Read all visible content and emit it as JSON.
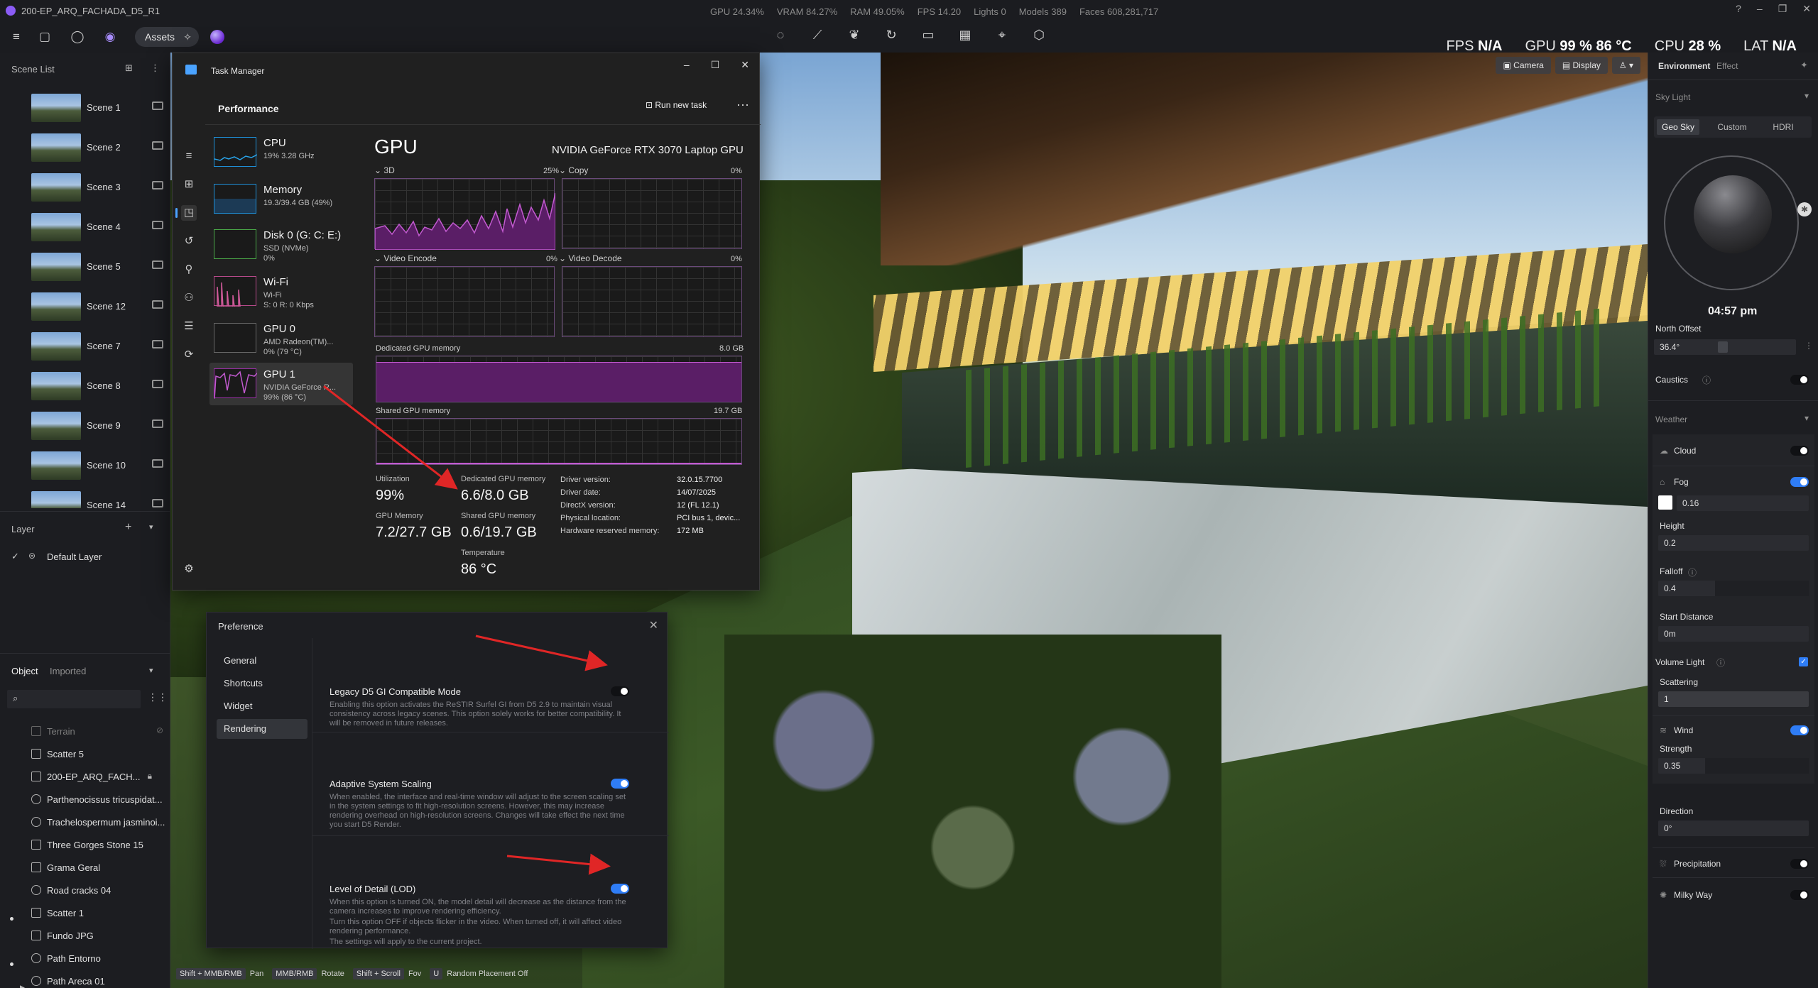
{
  "titlebar": {
    "title": "200-EP_ARQ_FACHADA_D5_R1",
    "stats": [
      "GPU 24.34%",
      "VRAM 84.27%",
      "RAM 49.05%",
      "FPS 14.20",
      "Lights 0",
      "Models 389",
      "Faces 608,281,717"
    ]
  },
  "toolbar": {
    "assets_label": "Assets"
  },
  "hud": {
    "fps_label": "FPS",
    "fps_value": "N/A",
    "gpu_label": "GPU",
    "gpu_value": "99 %  86 °C",
    "cpu_label": "CPU",
    "cpu_value": "28 %",
    "lat_label": "LAT",
    "lat_value": "N/A"
  },
  "left_panel": {
    "scene_list_title": "Scene List",
    "scenes": [
      "Scene 1",
      "Scene 2",
      "Scene 3",
      "Scene 4",
      "Scene 5",
      "Scene 12",
      "Scene 7",
      "Scene 8",
      "Scene 9",
      "Scene 10",
      "Scene 14"
    ],
    "layer_title": "Layer",
    "layer_default": "Default Layer",
    "tabs": [
      "Object",
      "Imported"
    ],
    "objects": [
      "Terrain",
      "Scatter 5",
      "200-EP_ARQ_FACH...",
      "Parthenocissus tricuspidat...",
      "Trachelospermum jasminoi...",
      "Three Gorges Stone 15",
      "Grama Geral",
      "Road cracks 04",
      "Scatter 1",
      "Fundo JPG",
      "Path Entorno",
      "Path Areca 01"
    ]
  },
  "viewport": {
    "buttons": [
      "Camera",
      "Display"
    ],
    "shortcuts": [
      {
        "key": "Shift + MMB/RMB",
        "action": "Pan"
      },
      {
        "key": "MMB/RMB",
        "action": "Rotate"
      },
      {
        "key": "Shift + Scroll",
        "action": "Fov"
      },
      {
        "key": "U",
        "action": "Random Placement Off"
      }
    ]
  },
  "right_panel": {
    "tabs": [
      "Environment",
      "Effect"
    ],
    "sky_light": "Sky Light",
    "sky_modes": [
      "Geo Sky",
      "Custom",
      "HDRI"
    ],
    "time": "04:57 pm",
    "north_offset_label": "North Offset",
    "north_offset_value": "36.4°",
    "caustics": "Caustics",
    "weather": "Weather",
    "cloud": "Cloud",
    "fog": "Fog",
    "fog_value": "0.16",
    "height_label": "Height",
    "height_value": "0.2",
    "falloff_label": "Falloff",
    "falloff_value": "0.4",
    "start_distance_label": "Start Distance",
    "start_distance_value": "0m",
    "volume_light": "Volume Light",
    "scattering_label": "Scattering",
    "scattering_value": "1",
    "wind": "Wind",
    "strength_label": "Strength",
    "strength_value": "0.35",
    "direction_label": "Direction",
    "direction_value": "0°",
    "precipitation": "Precipitation",
    "milky_way": "Milky Way"
  },
  "task_manager": {
    "title": "Task Manager",
    "section": "Performance",
    "run_new_task": "Run new task",
    "side_items": [
      {
        "name": "CPU",
        "sub1": "19%  3.28 GHz",
        "sub2": ""
      },
      {
        "name": "Memory",
        "sub1": "19.3/39.4 GB (49%)",
        "sub2": ""
      },
      {
        "name": "Disk 0 (G: C: E:)",
        "sub1": "SSD (NVMe)",
        "sub2": "0%"
      },
      {
        "name": "Wi-Fi",
        "sub1": "Wi-Fi",
        "sub2": "S: 0  R: 0 Kbps"
      },
      {
        "name": "GPU 0",
        "sub1": "AMD Radeon(TM)...",
        "sub2": "0%  (79 °C)"
      },
      {
        "name": "GPU 1",
        "sub1": "NVIDIA GeForce R...",
        "sub2": "99%  (86 °C)"
      }
    ],
    "gpu_title": "GPU",
    "gpu_model": "NVIDIA GeForce RTX 3070 Laptop GPU",
    "graphs": {
      "g3d": {
        "label": "3D",
        "pct": "25%"
      },
      "copy": {
        "label": "Copy",
        "pct": "0%"
      },
      "venc": {
        "label": "Video Encode",
        "pct": "0%"
      },
      "vdec": {
        "label": "Video Decode",
        "pct": "0%"
      },
      "dedicated": {
        "label": "Dedicated GPU memory",
        "max": "8.0 GB"
      },
      "shared": {
        "label": "Shared GPU memory",
        "max": "19.7 GB"
      }
    },
    "stats": {
      "utilization_label": "Utilization",
      "utilization": "99%",
      "dedicated_label": "Dedicated GPU memory",
      "dedicated": "6.6/8.0 GB",
      "gpu_memory_label": "GPU Memory",
      "gpu_memory": "7.2/27.7 GB",
      "shared_label": "Shared GPU memory",
      "shared": "0.6/19.7 GB",
      "temp_label": "Temperature",
      "temp": "86 °C"
    },
    "details": [
      {
        "k": "Driver version:",
        "v": "32.0.15.7700"
      },
      {
        "k": "Driver date:",
        "v": "14/07/2025"
      },
      {
        "k": "DirectX version:",
        "v": "12 (FL 12.1)"
      },
      {
        "k": "Physical location:",
        "v": "PCI bus 1, devic..."
      },
      {
        "k": "Hardware reserved memory:",
        "v": "172 MB"
      }
    ]
  },
  "preference": {
    "title": "Preference",
    "nav": [
      "General",
      "Shortcuts",
      "Widget",
      "Rendering"
    ],
    "legacy_title": "Legacy D5 GI Compatible Mode",
    "legacy_desc": "Enabling this option activates the ReSTIR Surfel GI from D5 2.9 to maintain visual consistency across legacy scenes. This option solely works for better compatibility. It will be removed in future releases.",
    "adaptive_title": "Adaptive System Scaling",
    "adaptive_desc": "When enabled, the interface and real-time window will adjust to the screen scaling set in the system settings to fit high-resolution screens. However, this may increase rendering overhead on high-resolution screens. Changes will take effect the next time you start D5 Render.",
    "lod_title": "Level of Detail  (LOD)",
    "lod_desc1": "When this option is turned ON, the model detail will decrease as the distance from the camera increases to improve rendering efficiency.",
    "lod_desc2": "Turn this option OFF if objects flicker in the video. When turned off, it will affect video rendering performance.",
    "lod_desc3": "The settings will apply to the current project."
  },
  "colors": {
    "accent": "#2f7df6",
    "tm_gpu": "#9b30a8",
    "arrow": "#e02626"
  }
}
